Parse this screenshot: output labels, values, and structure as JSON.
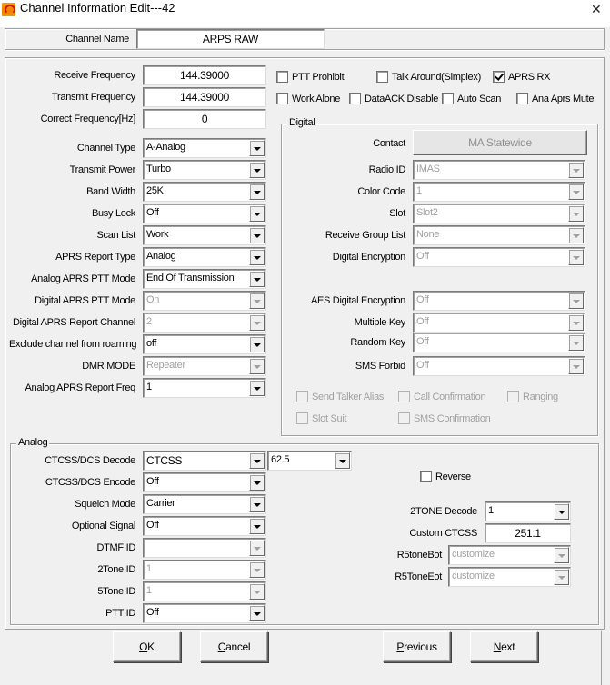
{
  "window": {
    "title": "Channel Information Edit---42",
    "close_icon": "close-icon",
    "app_icon": "app-logo-icon"
  },
  "header": {
    "channel_name_label": "Channel Name",
    "channel_name_value": "ARPS RAW"
  },
  "main": {
    "receive_frequency": {
      "label": "Receive Frequency",
      "value": "144.39000"
    },
    "transmit_frequency": {
      "label": "Transmit Frequency",
      "value": "144.39000"
    },
    "correct_frequency": {
      "label": "Correct Frequency[Hz]",
      "value": "0"
    },
    "combos": [
      {
        "label": "Channel Type",
        "value": "A-Analog",
        "enabled": true
      },
      {
        "label": "Transmit Power",
        "value": "Turbo",
        "enabled": true
      },
      {
        "label": "Band Width",
        "value": "25K",
        "enabled": true
      },
      {
        "label": "Busy Lock",
        "value": "Off",
        "enabled": true
      },
      {
        "label": "Scan List",
        "value": "Work",
        "enabled": true
      },
      {
        "label": "APRS Report Type",
        "value": "Analog",
        "enabled": true
      },
      {
        "label": "Analog APRS PTT Mode",
        "value": "End Of Transmission",
        "enabled": true
      },
      {
        "label": "Digital APRS PTT Mode",
        "value": "On",
        "enabled": false
      },
      {
        "label": "Digital APRS Report Channel",
        "value": "2",
        "enabled": false
      },
      {
        "label": "Exclude channel from roaming",
        "value": "off",
        "enabled": true
      },
      {
        "label": "DMR MODE",
        "value": "Repeater",
        "enabled": false
      },
      {
        "label": "Analog APRS Report Freq",
        "value": "1",
        "enabled": true
      }
    ],
    "checkboxes": [
      {
        "label": "PTT Prohibit",
        "checked": false
      },
      {
        "label": "Talk Around(Simplex)",
        "checked": false
      },
      {
        "label": "APRS RX",
        "checked": true
      },
      {
        "label": "Work Alone",
        "checked": false
      },
      {
        "label": "DataACK Disable",
        "checked": false
      },
      {
        "label": "Auto Scan",
        "checked": false
      },
      {
        "label": "Ana Aprs Mute",
        "checked": false
      }
    ]
  },
  "digital": {
    "title": "Digital",
    "contact_label": "Contact",
    "contact_value": "MA Statewide",
    "combos": [
      {
        "label": "Radio ID",
        "value": "IMAS"
      },
      {
        "label": "Color Code",
        "value": "1"
      },
      {
        "label": "Slot",
        "value": "Slot2"
      },
      {
        "label": "Receive Group List",
        "value": "None"
      },
      {
        "label": "Digital Encryption",
        "value": "Off"
      },
      {
        "label": "AES Digital Encryption",
        "value": "Off"
      },
      {
        "label": "Multiple Key",
        "value": "Off"
      },
      {
        "label": "Random Key",
        "value": "Off"
      },
      {
        "label": "SMS Forbid",
        "value": "Off"
      }
    ],
    "checkboxes": [
      {
        "label": "Send Talker Alias",
        "checked": false
      },
      {
        "label": "Call Confirmation",
        "checked": false
      },
      {
        "label": "Ranging",
        "checked": false
      },
      {
        "label": "Slot Suit",
        "checked": false
      },
      {
        "label": "SMS Confirmation",
        "checked": false
      }
    ]
  },
  "analog": {
    "title": "Analog",
    "ctcss_decode": {
      "label": "CTCSS/DCS Decode",
      "value": "CTCSS",
      "tone": "62.5"
    },
    "combos": [
      {
        "label": "CTCSS/DCS Encode",
        "value": "Off",
        "enabled": true
      },
      {
        "label": "Squelch Mode",
        "value": "Carrier",
        "enabled": true
      },
      {
        "label": "Optional Signal",
        "value": "Off",
        "enabled": true
      },
      {
        "label": "DTMF ID",
        "value": "",
        "enabled": false
      },
      {
        "label": "2Tone ID",
        "value": "1",
        "enabled": false
      },
      {
        "label": "5Tone ID",
        "value": "1",
        "enabled": false
      },
      {
        "label": "PTT ID",
        "value": "Off",
        "enabled": true
      }
    ],
    "reverse": {
      "label": "Reverse",
      "checked": false
    },
    "twotone_decode": {
      "label": "2TONE Decode",
      "value": "1"
    },
    "custom_ctcss": {
      "label": "Custom CTCSS",
      "value": "251.1"
    },
    "r5tone_bot": {
      "label": "R5toneBot",
      "value": "customize"
    },
    "r5tone_eot": {
      "label": "R5ToneEot",
      "value": "customize"
    }
  },
  "buttons": {
    "ok": {
      "label": "OK",
      "accel": "O"
    },
    "cancel": {
      "label": "Cancel",
      "accel": "C"
    },
    "previous": {
      "label": "Previous",
      "accel": "P"
    },
    "next": {
      "label": "Next",
      "accel": "N"
    }
  }
}
